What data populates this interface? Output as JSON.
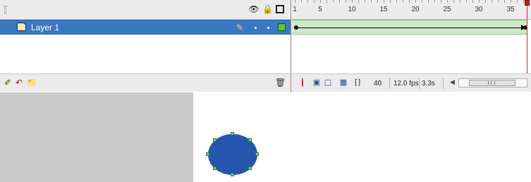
{
  "timeline": {
    "header_icons": [
      "eye-icon",
      "lock-icon",
      "outline-icon"
    ],
    "layer": {
      "name": "Layer 1",
      "icons": [
        "layer-type-icon",
        "pencil-icon"
      ],
      "outline_color": "#5ac14a",
      "selected_bg": "#3a78c3"
    },
    "layer_footer_icons": [
      "new-layer-icon",
      "add-motion-guide-icon",
      "new-folder-icon",
      "trash-icon"
    ],
    "ruler": {
      "labels": [
        "1",
        "5",
        "10",
        "15",
        "20",
        "25",
        "30",
        "35"
      ]
    },
    "frames": {
      "tween_color": "#cfe8c8",
      "keyframes": [
        "start",
        "end"
      ]
    },
    "status": {
      "current_frame": "40",
      "frame_rate": "12.0 fps",
      "elapsed_time": "3.3s"
    },
    "status_icons": [
      "center-frame-icon",
      "onion-skin-icon",
      "onion-skin-outlines-icon",
      "edit-multiple-frames-icon",
      "modify-onion-markers-icon"
    ]
  },
  "stage": {
    "pasteboard_color": "#c9c9c9",
    "stage_color": "#ffffff",
    "shape": {
      "type": "circle",
      "fill": "#2556ad",
      "handle_color": "#7ad46a"
    }
  }
}
